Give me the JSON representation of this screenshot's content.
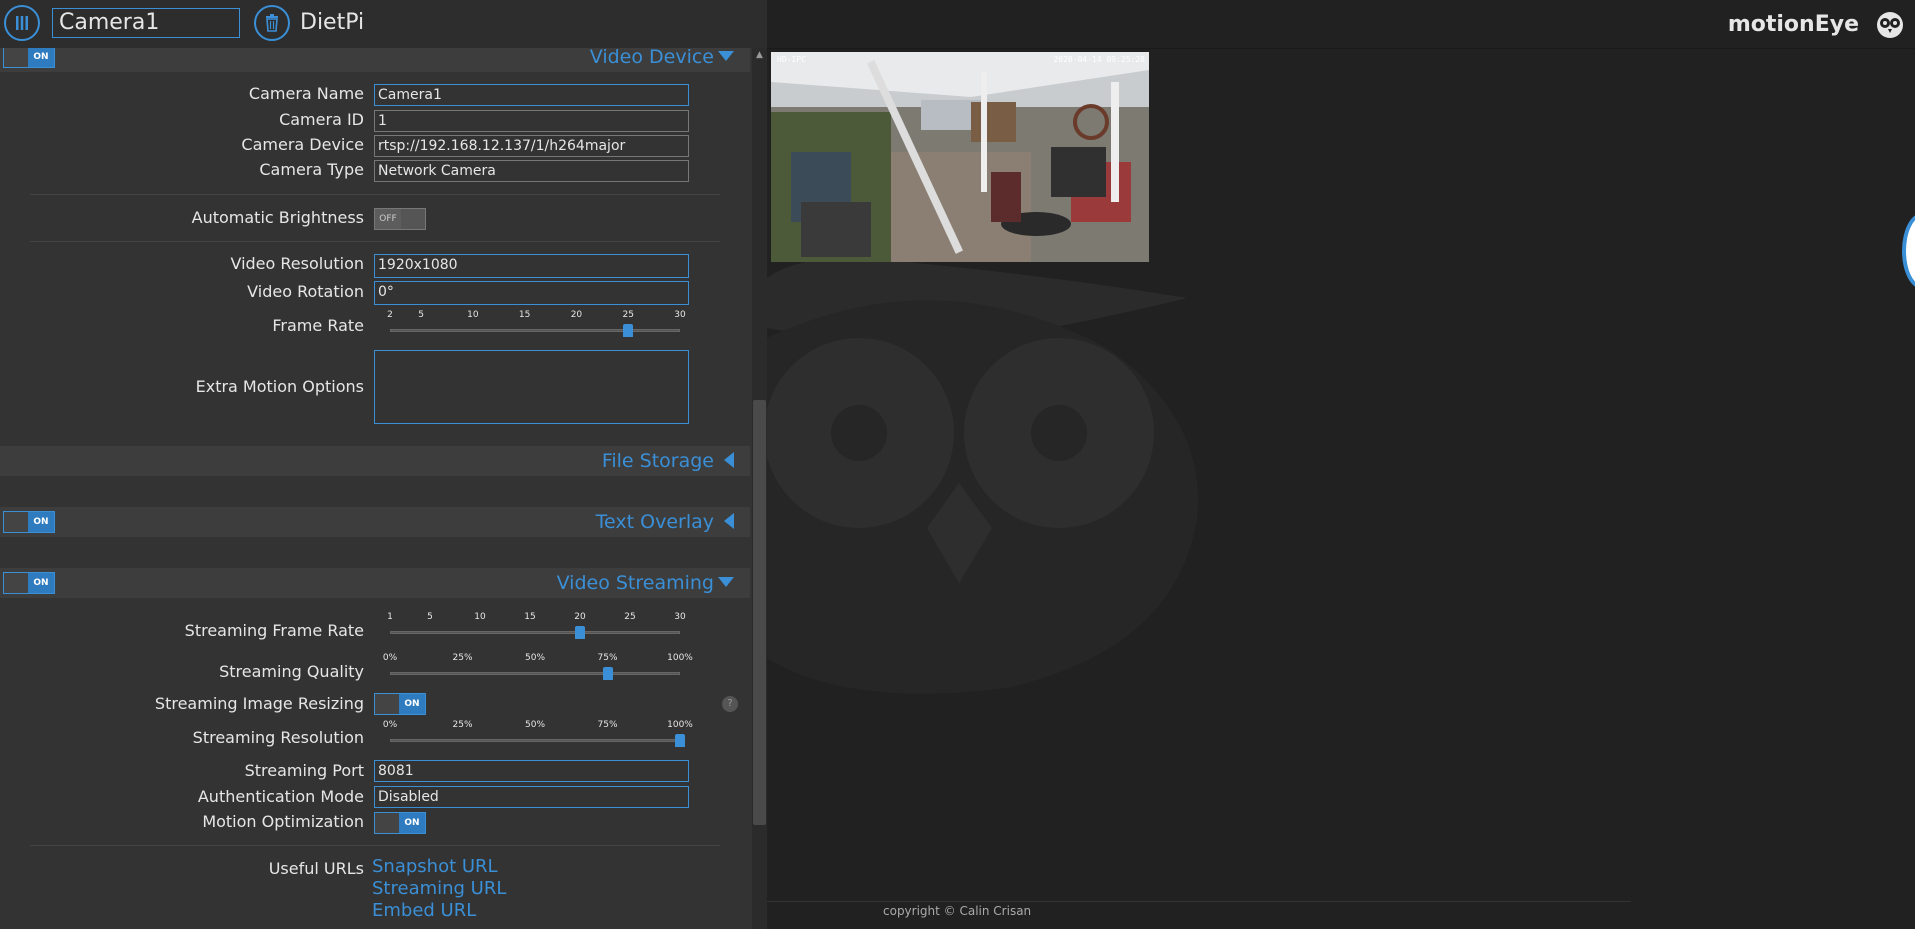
{
  "header": {
    "camera_select_value": "Camera1",
    "host_name": "DietPi",
    "brand": "motionEye",
    "icons": [
      "menu-icon",
      "trash-icon",
      "owl-logo-icon"
    ]
  },
  "colors": {
    "accent": "#3a8fd6",
    "panel": "#333333",
    "background": "#212121"
  },
  "video_device": {
    "title": "Video Device",
    "enabled_label": "ON",
    "camera_name_label": "Camera Name",
    "camera_name": "Camera1",
    "camera_id_label": "Camera ID",
    "camera_id": "1",
    "camera_device_label": "Camera Device",
    "camera_device": "rtsp://192.168.12.137/1/h264major",
    "camera_type_label": "Camera Type",
    "camera_type": "Network Camera",
    "auto_brightness_label": "Automatic Brightness",
    "auto_brightness": "OFF",
    "video_resolution_label": "Video Resolution",
    "video_resolution": "1920x1080",
    "video_rotation_label": "Video Rotation",
    "video_rotation": "0°",
    "frame_rate_label": "Frame Rate",
    "frame_rate_ticks": [
      "2",
      "5",
      "10",
      "15",
      "20",
      "25",
      "30"
    ],
    "frame_rate_value": 25,
    "extra_motion_label": "Extra Motion Options",
    "extra_motion": ""
  },
  "file_storage": {
    "title": "File Storage"
  },
  "text_overlay": {
    "title": "Text Overlay",
    "enabled_label": "ON"
  },
  "video_streaming": {
    "title": "Video Streaming",
    "enabled_label": "ON",
    "frame_rate_label": "Streaming Frame Rate",
    "frame_rate_ticks": [
      "1",
      "5",
      "10",
      "15",
      "20",
      "25",
      "30"
    ],
    "frame_rate_value": 20,
    "quality_label": "Streaming Quality",
    "quality_ticks": [
      "0%",
      "25%",
      "50%",
      "75%",
      "100%"
    ],
    "quality_value": 0.75,
    "resizing_label": "Streaming Image Resizing",
    "resizing": "ON",
    "help_label": "?",
    "resolution_label": "Streaming Resolution",
    "resolution_ticks": [
      "0%",
      "25%",
      "50%",
      "75%",
      "100%"
    ],
    "resolution_value": 1.0,
    "port_label": "Streaming Port",
    "port": "8081",
    "auth_label": "Authentication Mode",
    "auth": "Disabled",
    "motion_opt_label": "Motion Optimization",
    "motion_opt": "ON",
    "urls_label": "Useful URLs",
    "snapshot_url": "Snapshot URL",
    "streaming_url": "Streaming URL",
    "embed_url": "Embed URL"
  },
  "preview": {
    "overlay_left": "HD-IPC",
    "overlay_right": "2020-04-14  09:25:28"
  },
  "footer": {
    "copyright": "copyright © Calin Crisan"
  }
}
